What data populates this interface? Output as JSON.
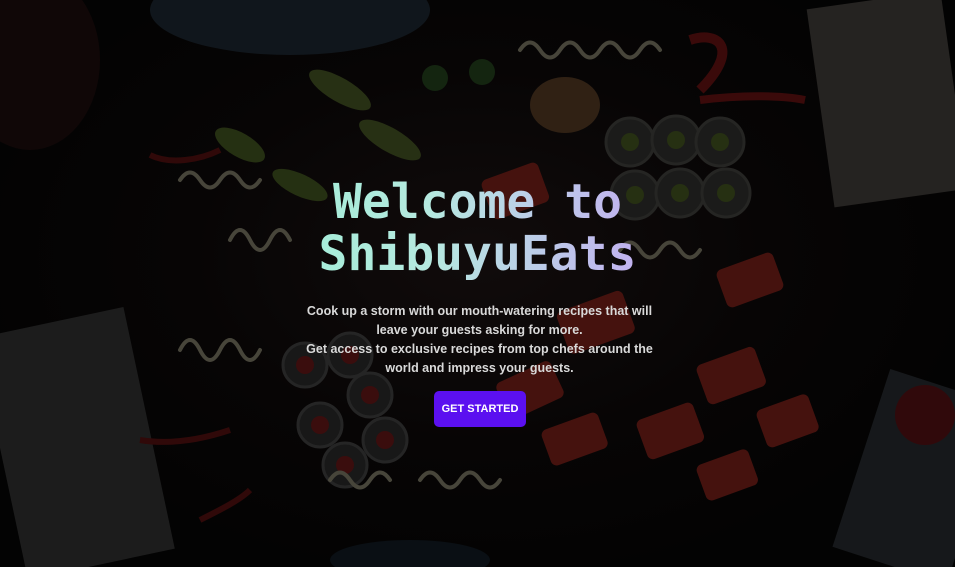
{
  "hero": {
    "title_line1": "Welcome to",
    "title_line2": "ShibuyuEats",
    "subtitle_line1": "Cook up a storm with our mouth-watering recipes that will",
    "subtitle_line2": "leave your guests asking for more.",
    "subtitle_line3": "Get access to exclusive recipes from top chefs around the",
    "subtitle_line4": "world and impress your guests.",
    "cta_label": "GET STARTED"
  },
  "colors": {
    "accent": "#5b10f0",
    "title_gradient_start": "#7cf5c6",
    "title_gradient_end": "#b58af2"
  }
}
